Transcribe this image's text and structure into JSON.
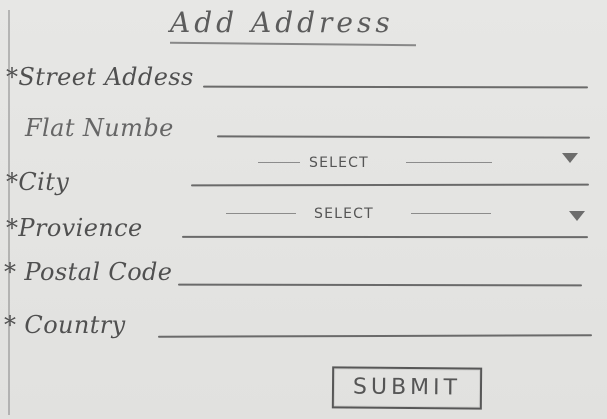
{
  "page": {
    "title": "Add Address"
  },
  "fields": {
    "street": {
      "label": "*Street Addess"
    },
    "flat": {
      "label": "Flat Numbe"
    },
    "city": {
      "label": "*City",
      "select_text": "SELECT",
      "caret_icon": "caret-down-icon"
    },
    "province": {
      "label": "*Provience",
      "select_text": "SELECT",
      "caret_icon": "caret-down-icon"
    },
    "postal": {
      "label": "* Postal Code"
    },
    "country": {
      "label": "* Country"
    }
  },
  "actions": {
    "submit_label": "SUBMIT"
  }
}
